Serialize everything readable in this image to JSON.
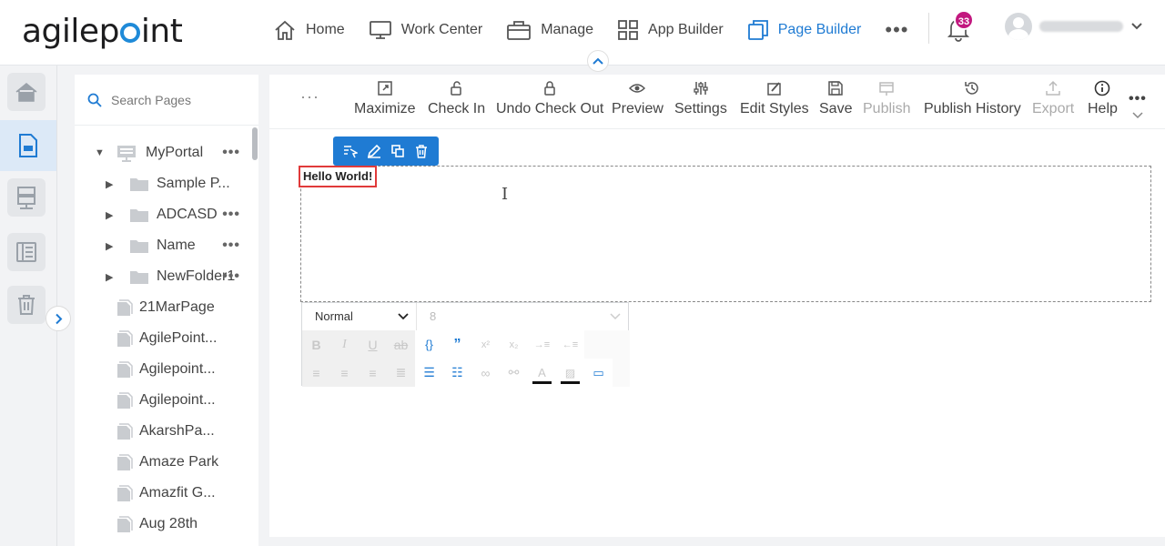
{
  "brand": {
    "logo_text_1": "agilep",
    "logo_text_2": "int",
    "accent": "#1f7bd3"
  },
  "nav": {
    "items": [
      {
        "label": "Home",
        "icon": "home-icon"
      },
      {
        "label": "Work Center",
        "icon": "monitor-icon"
      },
      {
        "label": "Manage",
        "icon": "briefcase-icon"
      },
      {
        "label": "App Builder",
        "icon": "grid-icon"
      },
      {
        "label": "Page Builder",
        "icon": "pages-icon",
        "active": true
      }
    ],
    "more": "•••",
    "notification_count": "33"
  },
  "search": {
    "placeholder": "Search Pages"
  },
  "tree": {
    "root": "MyPortal",
    "items": [
      {
        "label": "Sample P...",
        "type": "folder"
      },
      {
        "label": "ADCASD",
        "type": "folder"
      },
      {
        "label": "Name",
        "type": "folder"
      },
      {
        "label": "NewFolder1",
        "type": "folder"
      },
      {
        "label": "21MarPage",
        "type": "page"
      },
      {
        "label": "AgilePoint...",
        "type": "page"
      },
      {
        "label": "Agilepoint...",
        "type": "page"
      },
      {
        "label": "Agilepoint...",
        "type": "page"
      },
      {
        "label": "AkarshPa...",
        "type": "page"
      },
      {
        "label": "Amaze Park",
        "type": "page"
      },
      {
        "label": "Amazfit G...",
        "type": "page"
      },
      {
        "label": "Aug 28th",
        "type": "page"
      }
    ],
    "more": "•••"
  },
  "toolbar": {
    "overflow_left": "···",
    "maximize": "Maximize",
    "check_in": "Check In",
    "undo_check_out": "Undo Check Out",
    "preview": "Preview",
    "settings": "Settings",
    "edit_styles": "Edit Styles",
    "save": "Save",
    "publish": "Publish",
    "publish_history": "Publish History",
    "export": "Export",
    "help": "Help",
    "more": "•••"
  },
  "canvas": {
    "text": "Hello World!",
    "style_value": "Normal",
    "size_value": "8"
  }
}
